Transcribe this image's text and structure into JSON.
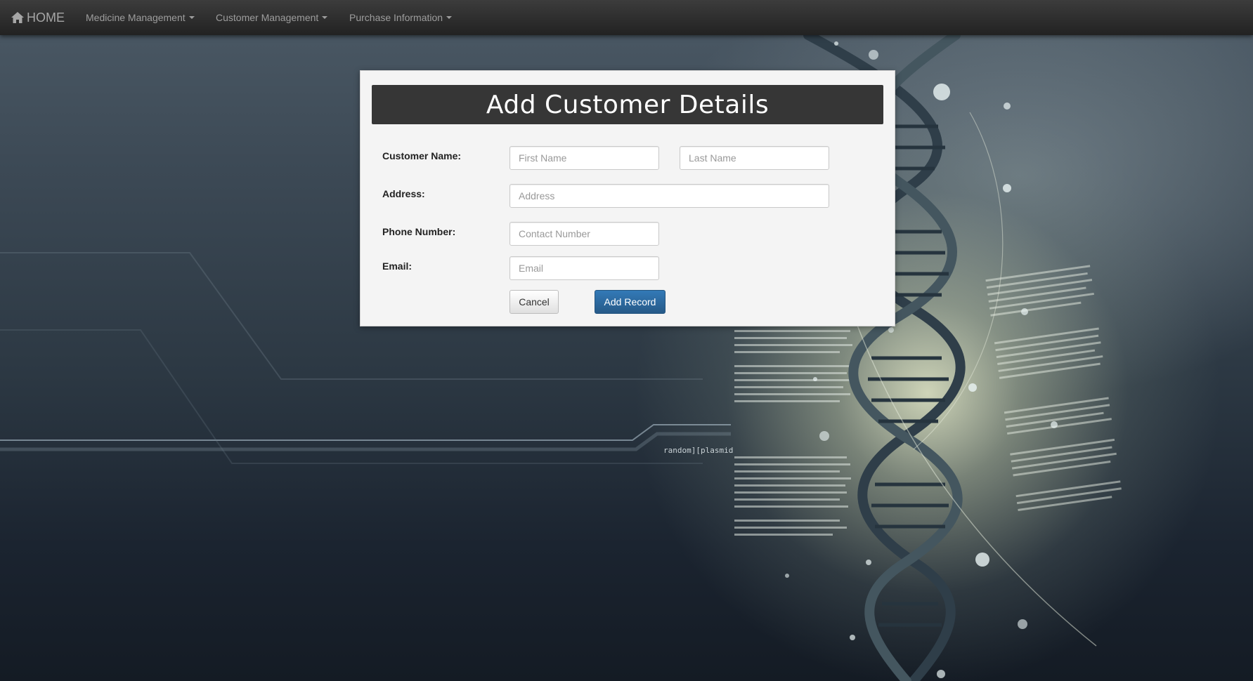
{
  "navbar": {
    "brand_label": "HOME",
    "brand_icon": "home-icon",
    "menus": [
      {
        "label": "Medicine Management"
      },
      {
        "label": "Customer Management"
      },
      {
        "label": "Purchase Information"
      }
    ]
  },
  "form": {
    "title": "Add Customer Details",
    "labels": {
      "customer_name": "Customer Name:",
      "address": "Address:",
      "phone": "Phone Number:",
      "email": "Email:"
    },
    "fields": {
      "first_name": {
        "value": "",
        "placeholder": "First Name"
      },
      "last_name": {
        "value": "",
        "placeholder": "Last Name"
      },
      "address": {
        "value": "",
        "placeholder": "Address"
      },
      "phone": {
        "value": "",
        "placeholder": "Contact Number"
      },
      "email": {
        "value": "",
        "placeholder": "Email"
      }
    },
    "buttons": {
      "cancel": "Cancel",
      "add": "Add Record"
    }
  },
  "background": {
    "watermark": "random][plasmid"
  },
  "colors": {
    "navbar": "#222222",
    "panel_header": "#363636",
    "primary_button": "#337ab7"
  }
}
